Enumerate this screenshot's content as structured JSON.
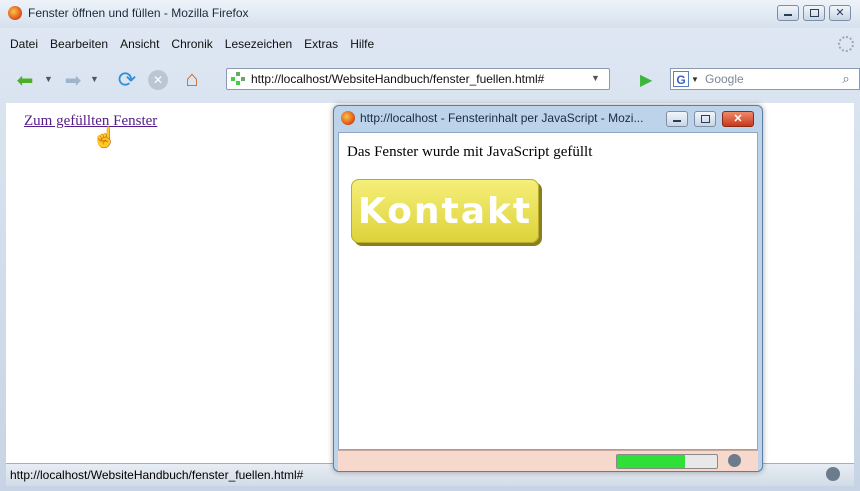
{
  "window": {
    "title": "Fenster öffnen und füllen - Mozilla Firefox"
  },
  "menu": [
    "Datei",
    "Bearbeiten",
    "Ansicht",
    "Chronik",
    "Lesezeichen",
    "Extras",
    "Hilfe"
  ],
  "navbar": {
    "url": "http://localhost/WebsiteHandbuch/fenster_fuellen.html#",
    "search_placeholder": "Google"
  },
  "content": {
    "link": "Zum gefüllten Fenster"
  },
  "status": {
    "text": "http://localhost/WebsiteHandbuch/fenster_fuellen.html#"
  },
  "popup": {
    "title": "http://localhost - Fensterinhalt per JavaScript - Mozi...",
    "text": "Das Fenster wurde mit JavaScript gefüllt",
    "button": "Kontakt",
    "progress": 0.68
  },
  "colors": {
    "link": "#551a8b",
    "button": "#e6dc4a",
    "progress": "#2fe039"
  }
}
